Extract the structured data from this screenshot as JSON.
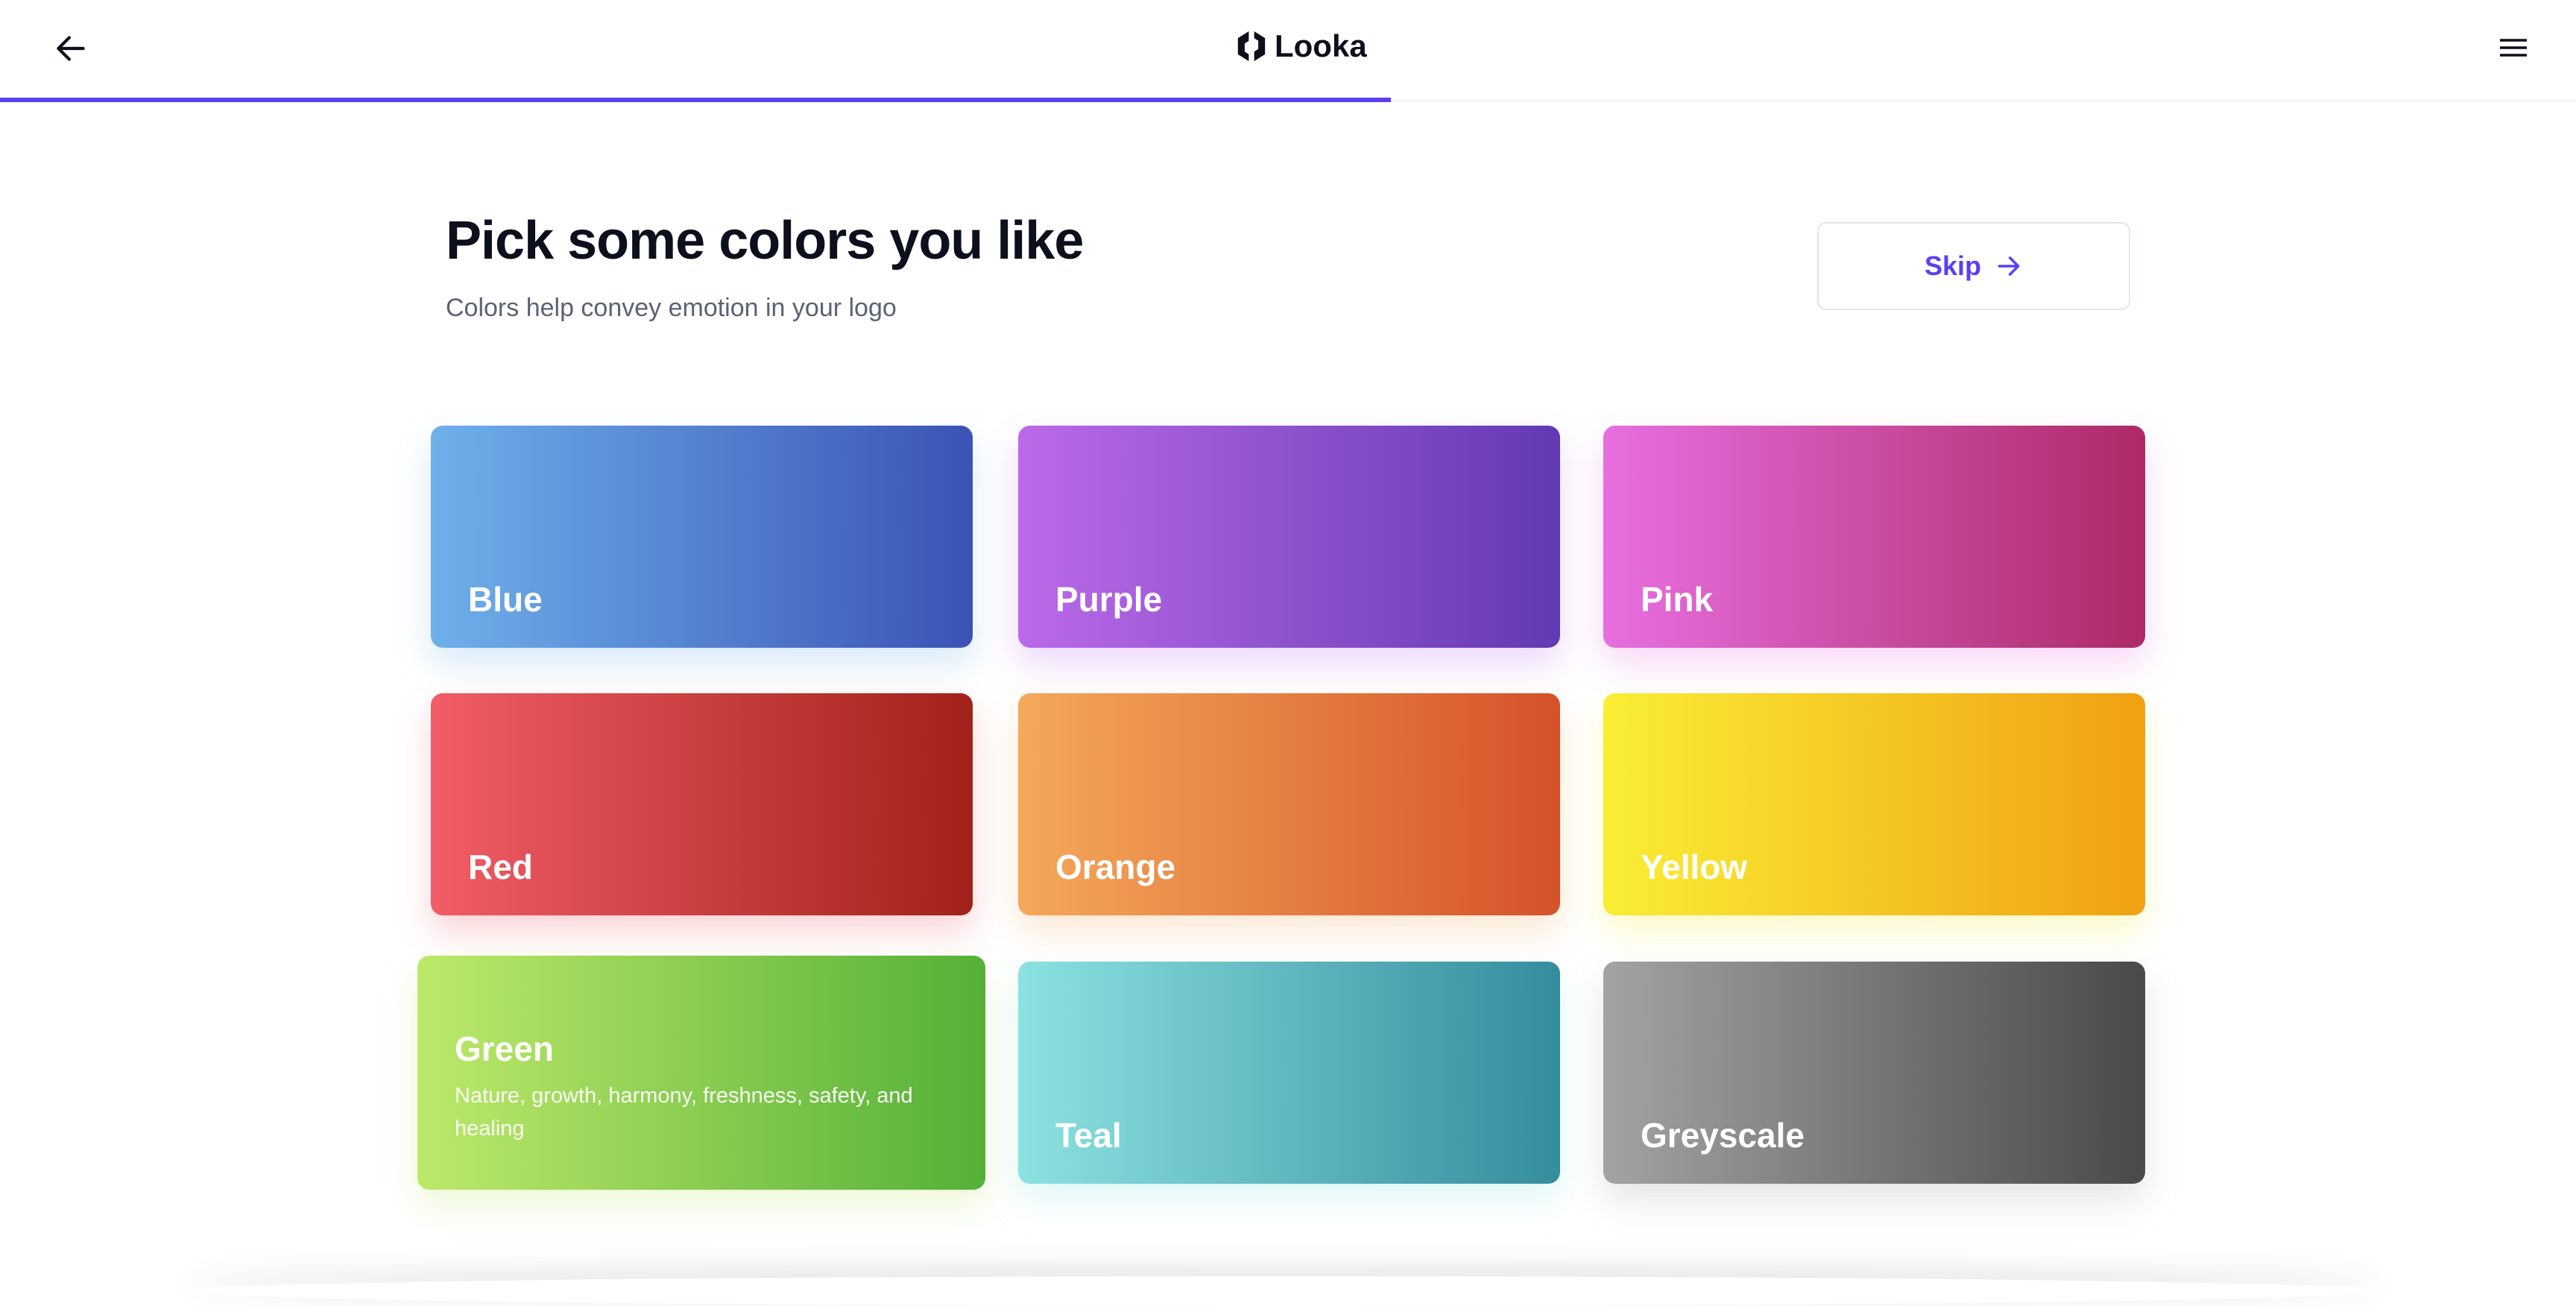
{
  "header": {
    "brand": "Looka",
    "progress_percent": 60
  },
  "page": {
    "title": "Pick some colors you like",
    "subtitle": "Colors help convey emotion in your logo",
    "skip_label": "Skip"
  },
  "colors": [
    {
      "label": "Blue",
      "from": "#6fb0ea",
      "to": "#3a53b5"
    },
    {
      "label": "Purple",
      "from": "#bb6ae8",
      "to": "#6239b4"
    },
    {
      "label": "Pink",
      "from": "#e86ee0",
      "to": "#ad2a66"
    },
    {
      "label": "Red",
      "from": "#f25c66",
      "to": "#a1221a"
    },
    {
      "label": "Orange",
      "from": "#f4a95a",
      "to": "#d5522a"
    },
    {
      "label": "Yellow",
      "from": "#f9ee34",
      "to": "#f0a112"
    },
    {
      "label": "Green",
      "description": "Nature, growth, harmony, freshness, safety, and healing",
      "from": "#bde96a",
      "to": "#55b038"
    },
    {
      "label": "Teal",
      "from": "#8ce2e0",
      "to": "#348c9e"
    },
    {
      "label": "Greyscale",
      "from": "#a3a3a3",
      "to": "#494949"
    }
  ]
}
